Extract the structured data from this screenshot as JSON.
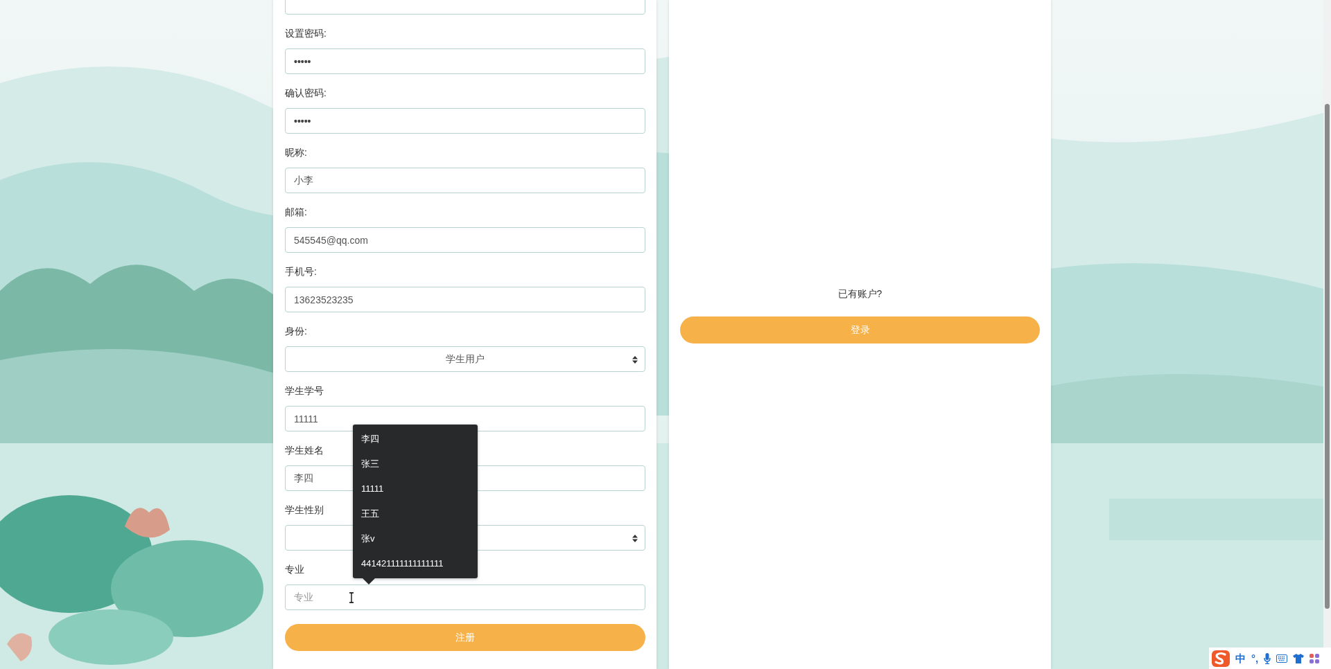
{
  "register_form": {
    "fields": [
      {
        "kind": "input"
      },
      {
        "kind": "password",
        "label": "设置密码:",
        "value": "•••••"
      },
      {
        "kind": "password",
        "label": "确认密码:",
        "value": "•••••"
      },
      {
        "kind": "input",
        "label": "昵称:",
        "value": "小李"
      },
      {
        "kind": "input",
        "label": "邮箱:",
        "value": "545545@qq.com"
      },
      {
        "kind": "input",
        "label": "手机号:",
        "value": "13623523235"
      },
      {
        "kind": "select",
        "label": "身份:",
        "value": "学生用户"
      },
      {
        "kind": "input",
        "label": "学生学号",
        "value": "11111"
      },
      {
        "kind": "input",
        "label": "学生姓名",
        "value": "李四"
      },
      {
        "kind": "select",
        "label": "学生性别"
      },
      {
        "kind": "input",
        "label": "专业",
        "placeholder": "专业"
      }
    ],
    "submit": "注册"
  },
  "suggestions": [
    "李四",
    "张三",
    "11111",
    "王五",
    "张v",
    "441421111111111111"
  ],
  "login_panel": {
    "prompt": "已有账户?",
    "button": "登录"
  },
  "ime_toolbar": {
    "mode": "中",
    "punctuation": "°,"
  }
}
